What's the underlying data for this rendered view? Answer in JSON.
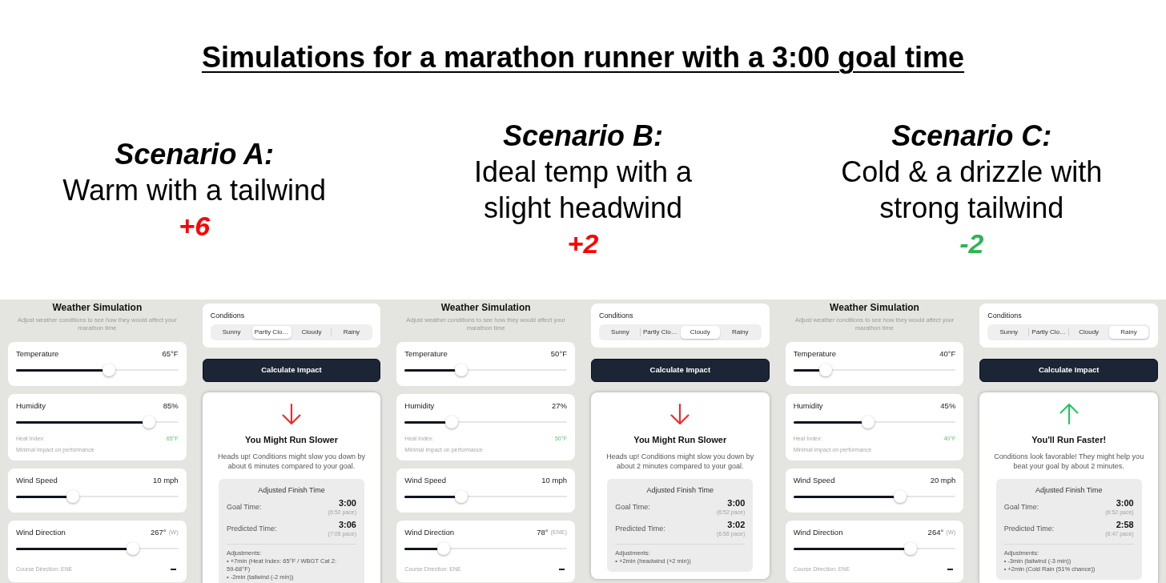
{
  "title": "Simulations for a marathon runner with a 3:00 goal time",
  "scenarios": [
    {
      "title": "Scenario A:",
      "description": "Warm with a tailwind",
      "delta": {
        "text": "+6",
        "color": "#ff0000"
      }
    },
    {
      "title": "Scenario B:",
      "description": "Ideal temp with a slight headwind",
      "delta": {
        "text": "+2",
        "color": "#ff0000"
      }
    },
    {
      "title": "Scenario C:",
      "description": "Cold & a drizzle with strong tailwind",
      "delta": {
        "text": "-2",
        "color": "#2db552"
      }
    }
  ],
  "simulations": [
    {
      "header": {
        "title": "Weather Simulation",
        "subtitle": "Adjust weather conditions to see how they would affect your marathon time"
      },
      "sliders": [
        {
          "kind": "basic",
          "label": "Temperature",
          "value": "65°F",
          "level": 0.57
        },
        {
          "kind": "heat",
          "label": "Humidity",
          "value": "85%",
          "level": 0.82,
          "heat_index_label": "Heat Index:",
          "heat_index": "65°F",
          "note": "Minimal impact on performance"
        },
        {
          "kind": "basic",
          "label": "Wind Speed",
          "value": "10 mph",
          "level": 0.35
        },
        {
          "kind": "direction",
          "label": "Wind Direction",
          "value": "267°",
          "compass": "(W)",
          "level": 0.72,
          "course": "Course Direction: ENE"
        }
      ],
      "conditions": {
        "label": "Conditions",
        "options": [
          {
            "label": "Sunny",
            "selected": false
          },
          {
            "label": "Partly Clo…",
            "selected": true
          },
          {
            "label": "Cloudy",
            "selected": false
          },
          {
            "label": "Rainy",
            "selected": false
          }
        ]
      },
      "button": "Calculate Impact",
      "result": {
        "kind": "slower",
        "title": "You Might Run Slower",
        "message": "Heads up! Conditions might slow you down by about 6 minutes compared to your goal.",
        "summary": {
          "title": "Adjusted Finish Time",
          "rows": [
            {
              "label": "Goal Time:",
              "time": "3:00",
              "pace": "(6:52 pace)"
            },
            {
              "label": "Predicted Time:",
              "time": "3:06",
              "pace": "(7:05 pace)"
            }
          ],
          "adjustments_label": "Adjustments:",
          "adjustments": [
            "• +7min (Heat Index: 65°F / WBGT Cat 2: 59-68°F)",
            "• -2min (tailwind (-2 min))"
          ]
        }
      }
    },
    {
      "header": {
        "title": "Weather Simulation",
        "subtitle": "Adjust weather conditions to see how they would affect your marathon time"
      },
      "sliders": [
        {
          "kind": "basic",
          "label": "Temperature",
          "value": "50°F",
          "level": 0.35
        },
        {
          "kind": "heat",
          "label": "Humidity",
          "value": "27%",
          "level": 0.29,
          "heat_index_label": "Heat Index:",
          "heat_index": "50°F",
          "note": "Minimal impact on performance"
        },
        {
          "kind": "basic",
          "label": "Wind Speed",
          "value": "10 mph",
          "level": 0.35
        },
        {
          "kind": "direction",
          "label": "Wind Direction",
          "value": "78°",
          "compass": "(ENE)",
          "level": 0.24,
          "course": "Course Direction: ENE"
        }
      ],
      "conditions": {
        "label": "Conditions",
        "options": [
          {
            "label": "Sunny",
            "selected": false
          },
          {
            "label": "Partly Clo…",
            "selected": false
          },
          {
            "label": "Cloudy",
            "selected": true
          },
          {
            "label": "Rainy",
            "selected": false
          }
        ]
      },
      "button": "Calculate Impact",
      "result": {
        "kind": "slower",
        "title": "You Might Run Slower",
        "message": "Heads up! Conditions might slow you down by about 2 minutes compared to your goal.",
        "summary": {
          "title": "Adjusted Finish Time",
          "rows": [
            {
              "label": "Goal Time:",
              "time": "3:00",
              "pace": "(6:52 pace)"
            },
            {
              "label": "Predicted Time:",
              "time": "3:02",
              "pace": "(6:56 pace)"
            }
          ],
          "adjustments_label": "Adjustments:",
          "adjustments": [
            "• +2min (headwind (+2 min))"
          ]
        }
      }
    },
    {
      "header": {
        "title": "Weather Simulation",
        "subtitle": "Adjust weather conditions to see how they would affect your marathon time"
      },
      "sliders": [
        {
          "kind": "basic",
          "label": "Temperature",
          "value": "40°F",
          "level": 0.2
        },
        {
          "kind": "heat",
          "label": "Humidity",
          "value": "45%",
          "level": 0.46,
          "heat_index_label": "Heat Index:",
          "heat_index": "40°F",
          "note": "Minimal impact on performance"
        },
        {
          "kind": "basic",
          "label": "Wind Speed",
          "value": "20 mph",
          "level": 0.66
        },
        {
          "kind": "direction",
          "label": "Wind Direction",
          "value": "264°",
          "compass": "(W)",
          "level": 0.72,
          "course": "Course Direction: ENE"
        }
      ],
      "conditions": {
        "label": "Conditions",
        "options": [
          {
            "label": "Sunny",
            "selected": false
          },
          {
            "label": "Partly Clo…",
            "selected": false
          },
          {
            "label": "Cloudy",
            "selected": false
          },
          {
            "label": "Rainy",
            "selected": true
          }
        ]
      },
      "button": "Calculate Impact",
      "result": {
        "kind": "faster",
        "title": "You'll Run Faster!",
        "message": "Conditions look favorable! They might help you beat your goal by about 2 minutes.",
        "summary": {
          "title": "Adjusted Finish Time",
          "rows": [
            {
              "label": "Goal Time:",
              "time": "3:00",
              "pace": "(6:52 pace)"
            },
            {
              "label": "Predicted Time:",
              "time": "2:58",
              "pace": "(6:47 pace)"
            }
          ],
          "adjustments_label": "Adjustments:",
          "adjustments": [
            "• -3min (tailwind (-3 min))",
            "• +2min (Cold Rain (51% chance))"
          ]
        }
      }
    }
  ]
}
